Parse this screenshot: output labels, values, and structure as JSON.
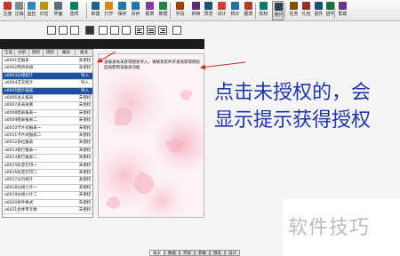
{
  "toolbar": {
    "items": [
      {
        "label": "注册",
        "color": "#c0392b"
      },
      {
        "label": "注销",
        "color": "#7f8c8d"
      },
      {
        "label": "监控",
        "color": "#2e86c1"
      },
      {
        "label": "日志",
        "color": "#b7950b"
      },
      {
        "label": "界面",
        "color": "#5d6d7e"
      },
      {
        "label": "选项",
        "color": "#117a65"
      },
      {
        "label": "新建",
        "color": "#1f618d"
      },
      {
        "label": "打开",
        "color": "#d68910"
      },
      {
        "label": "保存",
        "color": "#2874a6"
      },
      {
        "label": "另存",
        "color": "#2874a6"
      },
      {
        "label": "报表",
        "color": "#7d3c98"
      },
      {
        "label": "数据",
        "color": "#1e8449"
      },
      {
        "label": "字段",
        "color": "#a04000"
      },
      {
        "label": "转换",
        "color": "#5b2c6f"
      },
      {
        "label": "预览",
        "color": "#1a5276"
      },
      {
        "label": "设计",
        "color": "#cb4335"
      },
      {
        "label": "统计",
        "color": "#2471a3"
      },
      {
        "label": "图表",
        "color": "#b03a2e"
      },
      {
        "label": "授权",
        "color": "#117864"
      },
      {
        "label": "用户",
        "color": "#2e4053"
      },
      {
        "label": "任务",
        "color": "#7e5109"
      },
      {
        "label": "礼包",
        "color": "#943126"
      },
      {
        "label": "插件",
        "color": "#1b4f72"
      },
      {
        "label": "插件",
        "color": "#196f3d"
      },
      {
        "label": "帮助",
        "color": "#6c3483"
      }
    ],
    "active_index": 19
  },
  "list": {
    "headers": [
      "全选",
      "分组",
      "授权",
      "授权",
      "编号",
      "备注"
    ],
    "rows": [
      {
        "name": "a0001空报表",
        "status": "未授权",
        "selected": false
      },
      {
        "name": "a0002简单表格",
        "status": "未授权",
        "selected": false
      },
      {
        "name": "a0003分组统计",
        "status": "导入",
        "selected": true
      },
      {
        "name": "a0004交叉统计",
        "status": "导入",
        "selected": false
      },
      {
        "name": "a0005图片报表",
        "status": "导入",
        "selected": true
      },
      {
        "name": "a0006主从报表",
        "status": "未授权",
        "selected": false
      },
      {
        "name": "a0007多表关联",
        "status": "未授权",
        "selected": false
      },
      {
        "name": "a0008图表报表一",
        "status": "未授权",
        "selected": false
      },
      {
        "name": "a0009图表报表二",
        "status": "未授权",
        "selected": false
      },
      {
        "name": "a0010卡片式报表一",
        "status": "未授权",
        "selected": false
      },
      {
        "name": "a0011卡片式报表二",
        "status": "未授权",
        "selected": false
      },
      {
        "name": "a0012多栏报表",
        "status": "未授权",
        "selected": false
      },
      {
        "name": "a0013套打报表一",
        "status": "未授权",
        "selected": false
      },
      {
        "name": "a0014套打报表二",
        "status": "未授权",
        "selected": false
      },
      {
        "name": "a0015标签打印一",
        "status": "未授权",
        "selected": false
      },
      {
        "name": "a0016标签打印二",
        "status": "未授权",
        "selected": false
      },
      {
        "name": "a0017分页统计",
        "status": "未授权",
        "selected": false
      },
      {
        "name": "a0018分组小计一",
        "status": "未授权",
        "selected": false
      },
      {
        "name": "a0019分组小计二",
        "status": "未授权",
        "selected": false
      },
      {
        "name": "a0020条件格式",
        "status": "未授权",
        "selected": false
      },
      {
        "name": "a0021合并单元格",
        "status": "未授权",
        "selected": false
      }
    ]
  },
  "preview": {
    "message": "该报表尚未获得授权导入，请联系软件开发商获得授权后再使用该报表功能"
  },
  "annotation": {
    "line1": "点击未授权的，会",
    "line2": "显示提示获得授权"
  },
  "watermark": "软件技巧",
  "bottom_tabs": [
    "报表",
    "数据",
    "字段",
    "参数",
    "预览",
    "设计"
  ],
  "colors": {
    "selected_row": "#1f4fa3",
    "annotation": "#2034a8",
    "arrow": "#d92020"
  }
}
